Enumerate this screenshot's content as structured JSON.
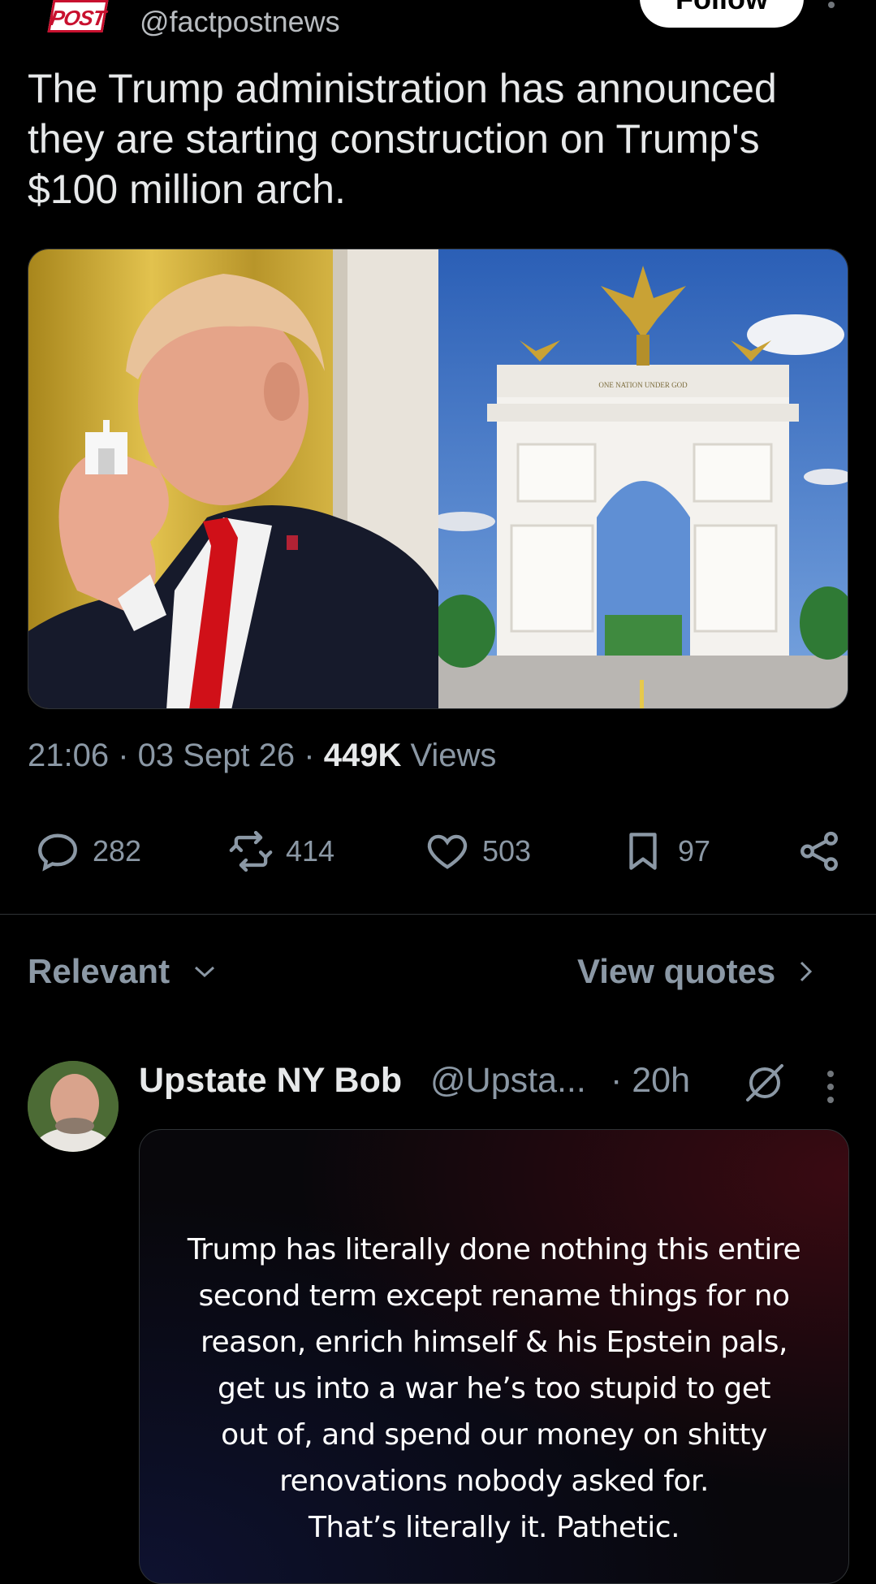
{
  "post": {
    "handle": "@factpostnews",
    "logo_text": "POST",
    "follow_label": "Follow",
    "text": "The Trump administration has announced they are starting construction on Trump's $100 million arch.",
    "time": "21:06",
    "date": "03 Sept 26",
    "views_count": "449K",
    "views_label": "Views",
    "arch_inscription": "ONE NATION UNDER GOD"
  },
  "actions": {
    "replies": "282",
    "reposts": "414",
    "likes": "503",
    "bookmarks": "97"
  },
  "filters": {
    "sort_label": "Relevant",
    "quotes_label": "View quotes"
  },
  "reply": {
    "name": "Upstate NY Bob",
    "handle": "@Upsta...",
    "time": "· 20h",
    "card_text": "Trump has literally done nothing this entire\nsecond term except rename things for no\nreason, enrich himself & his Epstein pals,\nget us into a war he’s too stupid to get\nout of, and spend our money on shitty\nrenovations nobody asked for.\nThat’s literally it. Pathetic."
  },
  "colors": {
    "background": "#000000",
    "text_primary": "#e7e9ea",
    "text_secondary": "#8b98a5",
    "logo_red": "#c8102e"
  },
  "icons": [
    "reply-icon",
    "repost-icon",
    "like-icon",
    "bookmark-icon",
    "share-icon",
    "chevron-down-icon",
    "chevron-right-icon",
    "grok-icon",
    "more-icon"
  ]
}
